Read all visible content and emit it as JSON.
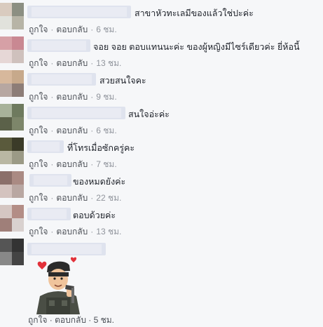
{
  "comments": [
    {
      "text": "สาขาหัวทะเลมีของแล้วใช่ปะค่ะ",
      "like_label": "ถูกใจ",
      "reply_label": "ตอบกลับ",
      "time": "6 ชม.",
      "avatar_colors": [
        "#d9cbbf",
        "#8c8f82",
        "#e1e2dc",
        "#b7b4a6"
      ]
    },
    {
      "text": "จอย จอย ตอบแทนนะค่ะ ของผู้หญิงมีไซร์เดียวค่ะ ยี่ห้อนี้",
      "like_label": "ถูกใจ",
      "reply_label": "ตอบกลับ",
      "time": "13 ชม.",
      "avatar_colors": [
        "#d6a0a6",
        "#c98892",
        "#e6d7d6",
        "#cfc1bd"
      ]
    },
    {
      "text": "สวยสนใจคะ",
      "like_label": "ถูกใจ",
      "reply_label": "ตอบกลับ",
      "time": "9 ชม.",
      "avatar_colors": [
        "#d7b89c",
        "#c7a98b",
        "#b7a7a1",
        "#8d7d77"
      ]
    },
    {
      "text": "สนใจอ่ะค่ะ",
      "like_label": "ถูกใจ",
      "reply_label": "ตอบกลับ",
      "time": "6 ชม.",
      "avatar_colors": [
        "#a8b29a",
        "#6e7a5e",
        "#5b6149",
        "#7d866a"
      ]
    },
    {
      "text": "ที่โทรเมื่อซักครู่คะ",
      "like_label": "ถูกใจ",
      "reply_label": "ตอบกลับ",
      "time": "7 ชม.",
      "avatar_colors": [
        "#5a5a3c",
        "#3b3b28",
        "#b9b7a3",
        "#9b9a86"
      ]
    },
    {
      "text": "ของหมดยังค่ะ",
      "like_label": "ถูกใจ",
      "reply_label": "ตอบกลับ",
      "time": "22 ชม.",
      "avatar_colors": [
        "#8b6f6a",
        "#aa8a83",
        "#d4c3bf",
        "#b9a7a2"
      ]
    },
    {
      "text": "ตอบด้วยค่ะ",
      "like_label": "ถูกใจ",
      "reply_label": "ตอบกลับ",
      "time": "13 ชม.",
      "avatar_colors": [
        "#d5c6c2",
        "#b38d86",
        "#9f7f79",
        "#d9d1cf"
      ]
    }
  ],
  "last_comment": {
    "avatar_colors": [
      "#555555",
      "#333333",
      "#888888",
      "#444444"
    ],
    "sticker": "soldier-sticker"
  },
  "cut_off_text": "ถูกใจ · ตอบกลับ · 5 ชม."
}
